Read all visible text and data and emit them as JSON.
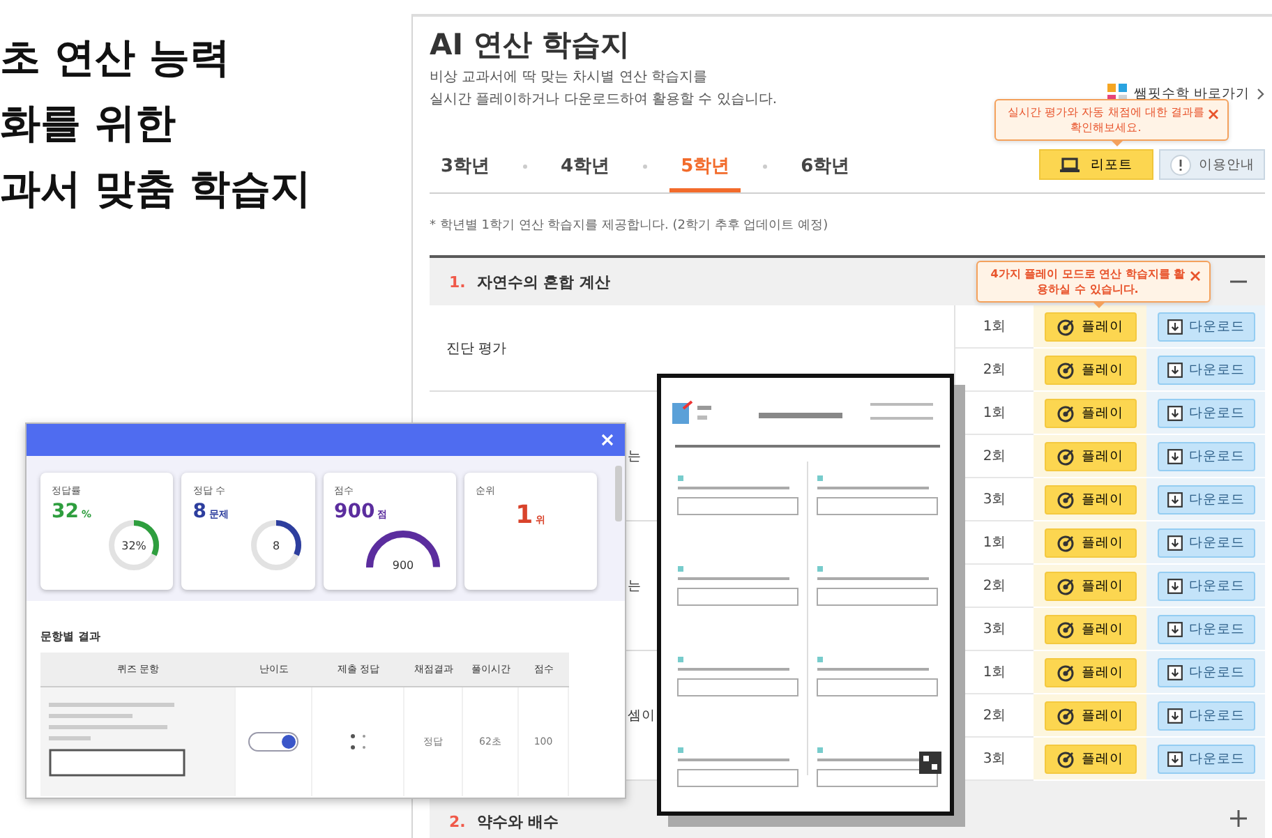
{
  "headline_lines": [
    "초 연산 능력",
    "화를 위한",
    "과서 맞춤 학습지"
  ],
  "panel": {
    "title": "AI 연산 학습지",
    "description": [
      "비상 교과서에 딱 맞는 차시별 연산 학습지를",
      "실시간 플레이하거나 다운로드하여 활용할 수 있습니다."
    ],
    "shortcut_link": "쌤핏수학 바로가기",
    "tabs": [
      {
        "label": "3학년",
        "selected": false
      },
      {
        "label": "4학년",
        "selected": false
      },
      {
        "label": "5학년",
        "selected": true
      },
      {
        "label": "6학년",
        "selected": false
      }
    ],
    "report_button": "리포트",
    "guide_button": "이용안내",
    "report_tooltip": "실시간 평가와 자동 채점에 대한 결과를 확인해보세요.",
    "note": "* 학년별 1학기 연산 학습지를 제공합니다. (2학기 추후 업데이트 예정)",
    "sections": [
      {
        "number": "1.",
        "title": "자연수의 혼합 계산",
        "expanded": true,
        "tooltip": "4가지 플레이 모드로 연산 학습지를 활용하실 수 있습니다.",
        "groups": [
          {
            "label": "진단 평가",
            "rows": [
              {
                "count": "1회",
                "play": "플레이",
                "download": "다운로드"
              },
              {
                "count": "2회",
                "play": "플레이",
                "download": "다운로드"
              }
            ]
          },
          {
            "label": "는",
            "rows": [
              {
                "count": "1회",
                "play": "플레이",
                "download": "다운로드"
              },
              {
                "count": "2회",
                "play": "플레이",
                "download": "다운로드"
              },
              {
                "count": "3회",
                "play": "플레이",
                "download": "다운로드"
              }
            ]
          },
          {
            "label": "는",
            "rows": [
              {
                "count": "1회",
                "play": "플레이",
                "download": "다운로드"
              },
              {
                "count": "2회",
                "play": "플레이",
                "download": "다운로드"
              },
              {
                "count": "3회",
                "play": "플레이",
                "download": "다운로드"
              }
            ]
          },
          {
            "label": "셈이",
            "rows": [
              {
                "count": "1회",
                "play": "플레이",
                "download": "다운로드"
              },
              {
                "count": "2회",
                "play": "플레이",
                "download": "다운로드"
              },
              {
                "count": "3회",
                "play": "플레이",
                "download": "다운로드"
              }
            ]
          }
        ]
      },
      {
        "number": "2.",
        "title": "약수와 배수",
        "expanded": false
      }
    ]
  },
  "report_popup": {
    "stat_cards": [
      {
        "kind": "ring",
        "label": "정답률",
        "value": "32",
        "unit": "%",
        "chart_text": "32%",
        "level": 0.32,
        "color": "#2e9e3e"
      },
      {
        "kind": "ring",
        "label": "정답 수",
        "value": "8",
        "unit": "문제",
        "chart_text": "8",
        "level": 0.32,
        "color": "#2d3e9e"
      },
      {
        "kind": "gauge",
        "label": "점수",
        "value": "900",
        "unit": "점",
        "chart_text": "900",
        "level": 1,
        "color": "#5b2d9e"
      },
      {
        "kind": "rank",
        "label": "순위",
        "value": "1",
        "unit": "위",
        "color": "#d9432b"
      }
    ],
    "results_title": "문항별 결과",
    "columns": [
      "퀴즈 문항",
      "난이도",
      "제출 정답",
      "채점결과",
      "풀이시간",
      "점수"
    ],
    "row_results": [
      "정답",
      "62초",
      "100"
    ]
  }
}
